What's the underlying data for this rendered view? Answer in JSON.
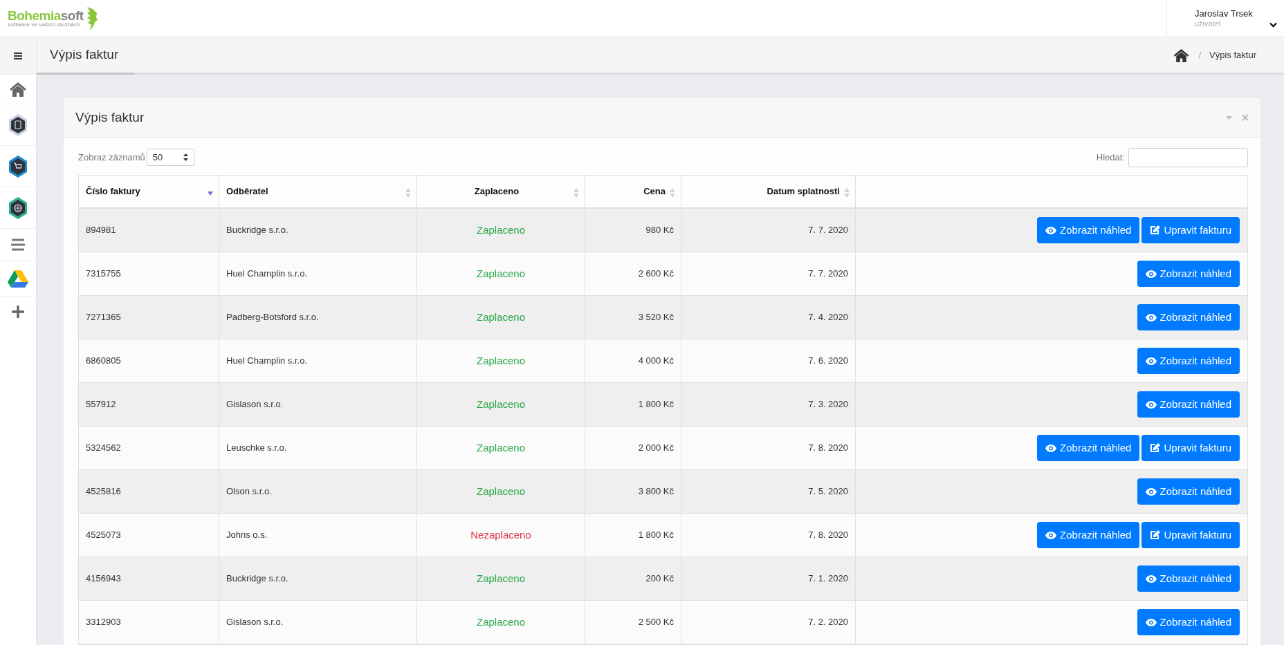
{
  "logo": {
    "brand_a": "Bohemia",
    "brand_b": "soft",
    "tagline": "software ve vašich službách"
  },
  "user": {
    "name": "Jaroslav Trsek",
    "role": "uživatel"
  },
  "page_title": "Výpis faktur",
  "breadcrumb": {
    "separator": "/",
    "current": "Výpis faktur"
  },
  "card": {
    "title": "Výpis faktur"
  },
  "length": {
    "label": "Zobraz záznamů",
    "value": "50"
  },
  "search": {
    "label": "Hledat:"
  },
  "columns": [
    {
      "label": "Číslo faktury",
      "sorted": true
    },
    {
      "label": "Odběratel",
      "sorted": false
    },
    {
      "label": "Zaplaceno",
      "sorted": false
    },
    {
      "label": "Cena",
      "sorted": false
    },
    {
      "label": "Datum splatnosti",
      "sorted": false
    }
  ],
  "rows": [
    {
      "number": "894981",
      "customer": "Buckridge s.r.o.",
      "status": "Zaplaceno",
      "paid": true,
      "price": "980 Kč",
      "due": "7. 7. 2020",
      "actions": [
        {
          "kind": "view",
          "label": "Zobrazit náhled"
        },
        {
          "kind": "edit",
          "label": "Upravit fakturu"
        }
      ]
    },
    {
      "number": "7315755",
      "customer": "Huel Champlin s.r.o.",
      "status": "Zaplaceno",
      "paid": true,
      "price": "2 600 Kč",
      "due": "7. 7. 2020",
      "actions": [
        {
          "kind": "view",
          "label": "Zobrazit náhled"
        }
      ]
    },
    {
      "number": "7271365",
      "customer": "Padberg-Botsford s.r.o.",
      "status": "Zaplaceno",
      "paid": true,
      "price": "3 520 Kč",
      "due": "7. 4. 2020",
      "actions": [
        {
          "kind": "view",
          "label": "Zobrazit náhled"
        }
      ]
    },
    {
      "number": "6860805",
      "customer": "Huel Champlin s.r.o.",
      "status": "Zaplaceno",
      "paid": true,
      "price": "4 000 Kč",
      "due": "7. 6. 2020",
      "actions": [
        {
          "kind": "view",
          "label": "Zobrazit náhled"
        }
      ]
    },
    {
      "number": "557912",
      "customer": "Gislason s.r.o.",
      "status": "Zaplaceno",
      "paid": true,
      "price": "1 800 Kč",
      "due": "7. 3. 2020",
      "actions": [
        {
          "kind": "view",
          "label": "Zobrazit náhled"
        }
      ]
    },
    {
      "number": "5324562",
      "customer": "Leuschke s.r.o.",
      "status": "Zaplaceno",
      "paid": true,
      "price": "2 000 Kč",
      "due": "7. 8. 2020",
      "actions": [
        {
          "kind": "view",
          "label": "Zobrazit náhled"
        },
        {
          "kind": "edit",
          "label": "Upravit fakturu"
        }
      ]
    },
    {
      "number": "4525816",
      "customer": "Olson s.r.o.",
      "status": "Zaplaceno",
      "paid": true,
      "price": "3 800 Kč",
      "due": "7. 5. 2020",
      "actions": [
        {
          "kind": "view",
          "label": "Zobrazit náhled"
        }
      ]
    },
    {
      "number": "4525073",
      "customer": "Johns o.s.",
      "status": "Nezaplaceno",
      "paid": false,
      "price": "1 800 Kč",
      "due": "7. 8. 2020",
      "actions": [
        {
          "kind": "view",
          "label": "Zobrazit náhled"
        },
        {
          "kind": "edit",
          "label": "Upravit fakturu"
        }
      ]
    },
    {
      "number": "4156943",
      "customer": "Buckridge s.r.o.",
      "status": "Zaplaceno",
      "paid": true,
      "price": "200 Kč",
      "due": "7. 1. 2020",
      "actions": [
        {
          "kind": "view",
          "label": "Zobrazit náhled"
        }
      ]
    },
    {
      "number": "3312903",
      "customer": "Gislason s.r.o.",
      "status": "Zaplaceno",
      "paid": true,
      "price": "2 500 Kč",
      "due": "7. 2. 2020",
      "actions": [
        {
          "kind": "view",
          "label": "Zobrazit náhled"
        }
      ]
    }
  ]
}
